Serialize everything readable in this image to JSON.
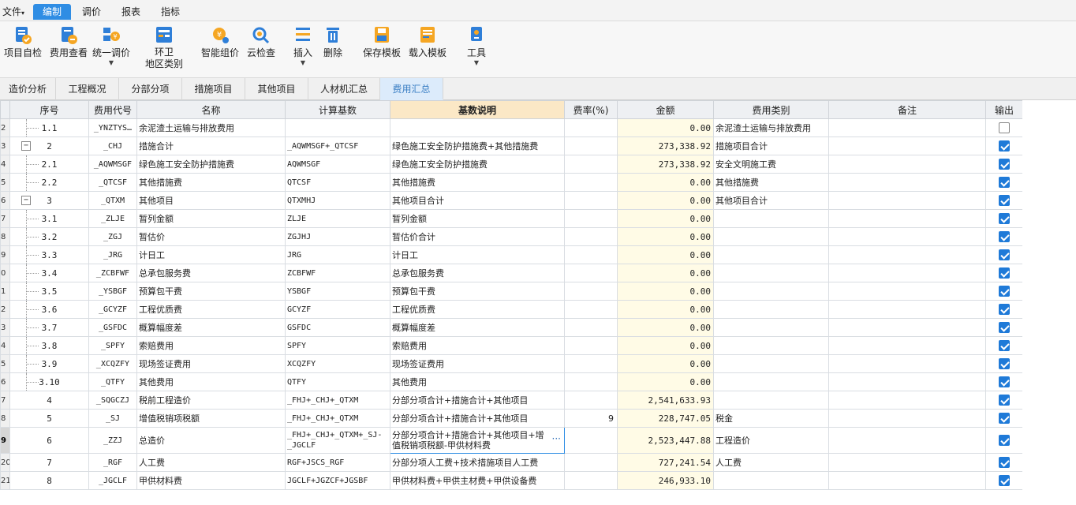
{
  "menubar": {
    "file": "文件",
    "items": [
      "编制",
      "调价",
      "报表",
      "指标"
    ]
  },
  "ribbon": {
    "buttons": [
      {
        "label": "项目自检",
        "icon": "project-check-icon"
      },
      {
        "label": "费用查看",
        "icon": "fee-view-icon"
      },
      {
        "label": "统一调价",
        "icon": "unified-price-icon"
      },
      {
        "label": "环卫\n地区类别",
        "icon": "sanitation-region-icon"
      },
      {
        "label": "智能组价",
        "icon": "smart-pricing-icon"
      },
      {
        "label": "云检查",
        "icon": "cloud-check-icon"
      },
      {
        "label": "插入",
        "icon": "insert-icon"
      },
      {
        "label": "删除",
        "icon": "delete-icon"
      },
      {
        "label": "保存模板",
        "icon": "save-template-icon"
      },
      {
        "label": "载入模板",
        "icon": "load-template-icon"
      },
      {
        "label": "工具",
        "icon": "tools-icon"
      }
    ],
    "label_sanitation_1": "环卫",
    "label_sanitation_2": "地区类别"
  },
  "tabs": [
    "造价分析",
    "工程概况",
    "分部分项",
    "措施项目",
    "其他项目",
    "人材机汇总",
    "费用汇总"
  ],
  "active_tab": "费用汇总",
  "grid": {
    "headers": [
      "序号",
      "费用代号",
      "名称",
      "计算基数",
      "基数说明",
      "费率(%)",
      "金额",
      "费用类别",
      "备注",
      "输出"
    ],
    "rows": [
      {
        "rn": "2",
        "seq": "1.1",
        "code": "_YNZTYS…",
        "name": "余泥渣土运输与排放费用",
        "base": "",
        "desc": "",
        "rate": "",
        "amount": "0.00",
        "category": "余泥渣土运输与排放费用",
        "note": "",
        "output": false,
        "level": 2
      },
      {
        "rn": "3",
        "seq": "2",
        "code": "_CHJ",
        "name": "措施合计",
        "base": "_AQWMSGF+_QTCSF",
        "desc": "绿色施工安全防护措施费+其他措施费",
        "rate": "",
        "amount": "273,338.92",
        "category": "措施项目合计",
        "note": "",
        "output": true,
        "level": 1
      },
      {
        "rn": "4",
        "seq": "2.1",
        "code": "_AQWMSGF",
        "name": "绿色施工安全防护措施费",
        "base": "AQWMSGF",
        "desc": "绿色施工安全防护措施费",
        "rate": "",
        "amount": "273,338.92",
        "category": "安全文明施工费",
        "note": "",
        "output": true,
        "level": 2
      },
      {
        "rn": "5",
        "seq": "2.2",
        "code": "_QTCSF",
        "name": "其他措施费",
        "base": "QTCSF",
        "desc": "其他措施费",
        "rate": "",
        "amount": "0.00",
        "category": "其他措施费",
        "note": "",
        "output": true,
        "level": 2
      },
      {
        "rn": "6",
        "seq": "3",
        "code": "_QTXM",
        "name": "其他项目",
        "base": "QTXMHJ",
        "desc": "其他项目合计",
        "rate": "",
        "amount": "0.00",
        "category": "其他项目合计",
        "note": "",
        "output": true,
        "level": 1
      },
      {
        "rn": "7",
        "seq": "3.1",
        "code": "_ZLJE",
        "name": "暂列金额",
        "base": "ZLJE",
        "desc": "暂列金额",
        "rate": "",
        "amount": "0.00",
        "category": "",
        "note": "",
        "output": true,
        "level": 2
      },
      {
        "rn": "8",
        "seq": "3.2",
        "code": "_ZGJ",
        "name": "暂估价",
        "base": "ZGJHJ",
        "desc": "暂估价合计",
        "rate": "",
        "amount": "0.00",
        "category": "",
        "note": "",
        "output": true,
        "level": 2
      },
      {
        "rn": "9",
        "seq": "3.3",
        "code": "_JRG",
        "name": "计日工",
        "base": "JRG",
        "desc": "计日工",
        "rate": "",
        "amount": "0.00",
        "category": "",
        "note": "",
        "output": true,
        "level": 2
      },
      {
        "rn": "0",
        "seq": "3.4",
        "code": "_ZCBFWF",
        "name": "总承包服务费",
        "base": "ZCBFWF",
        "desc": "总承包服务费",
        "rate": "",
        "amount": "0.00",
        "category": "",
        "note": "",
        "output": true,
        "level": 2
      },
      {
        "rn": "1",
        "seq": "3.5",
        "code": "_YSBGF",
        "name": "预算包干费",
        "base": "YSBGF",
        "desc": "预算包干费",
        "rate": "",
        "amount": "0.00",
        "category": "",
        "note": "",
        "output": true,
        "level": 2
      },
      {
        "rn": "2",
        "seq": "3.6",
        "code": "_GCYZF",
        "name": "工程优质费",
        "base": "GCYZF",
        "desc": "工程优质费",
        "rate": "",
        "amount": "0.00",
        "category": "",
        "note": "",
        "output": true,
        "level": 2
      },
      {
        "rn": "3",
        "seq": "3.7",
        "code": "_GSFDC",
        "name": "概算幅度差",
        "base": "GSFDC",
        "desc": "概算幅度差",
        "rate": "",
        "amount": "0.00",
        "category": "",
        "note": "",
        "output": true,
        "level": 2
      },
      {
        "rn": "4",
        "seq": "3.8",
        "code": "_SPFY",
        "name": "索赔费用",
        "base": "SPFY",
        "desc": "索赔费用",
        "rate": "",
        "amount": "0.00",
        "category": "",
        "note": "",
        "output": true,
        "level": 2
      },
      {
        "rn": "5",
        "seq": "3.9",
        "code": "_XCQZFY",
        "name": "现场签证费用",
        "base": "XCQZFY",
        "desc": "现场签证费用",
        "rate": "",
        "amount": "0.00",
        "category": "",
        "note": "",
        "output": true,
        "level": 2
      },
      {
        "rn": "6",
        "seq": "3.10",
        "code": "_QTFY",
        "name": "其他费用",
        "base": "QTFY",
        "desc": "其他费用",
        "rate": "",
        "amount": "0.00",
        "category": "",
        "note": "",
        "output": true,
        "level": 2
      },
      {
        "rn": "7",
        "seq": "4",
        "code": "_SQGCZJ",
        "name": "税前工程造价",
        "base": "_FHJ+_CHJ+_QTXM",
        "desc": "分部分项合计+措施合计+其他项目",
        "rate": "",
        "amount": "2,541,633.93",
        "category": "",
        "note": "",
        "output": true,
        "level": 0
      },
      {
        "rn": "8",
        "seq": "5",
        "code": "_SJ",
        "name": "增值税销项税额",
        "base": "_FHJ+_CHJ+_QTXM",
        "desc": "分部分项合计+措施合计+其他项目",
        "rate": "9",
        "amount": "228,747.05",
        "category": "税金",
        "note": "",
        "output": true,
        "level": 0
      },
      {
        "rn": "9",
        "seq": "6",
        "code": "_ZZJ",
        "name": "总造价",
        "base": "_FHJ+_CHJ+_QTXM+_SJ-_JGCLF",
        "desc": "分部分项合计+措施合计+其他项目+增值税销项税额-甲供材料费",
        "rate": "",
        "amount": "2,523,447.88",
        "category": "工程造价",
        "note": "",
        "output": true,
        "level": 0,
        "selected": true
      },
      {
        "rn": "20",
        "seq": "7",
        "code": "_RGF",
        "name": "人工费",
        "base": "RGF+JSCS_RGF",
        "desc": "分部分项人工费+技术措施项目人工费",
        "rate": "",
        "amount": "727,241.54",
        "category": "人工费",
        "note": "",
        "output": true,
        "level": 0
      },
      {
        "rn": "21",
        "seq": "8",
        "code": "_JGCLF",
        "name": "甲供材料费",
        "base": "JGCLF+JGZCF+JGSBF",
        "desc": "甲供材料费+甲供主材费+甲供设备费",
        "rate": "",
        "amount": "246,933.10",
        "category": "",
        "note": "",
        "output": true,
        "level": 0
      }
    ]
  }
}
